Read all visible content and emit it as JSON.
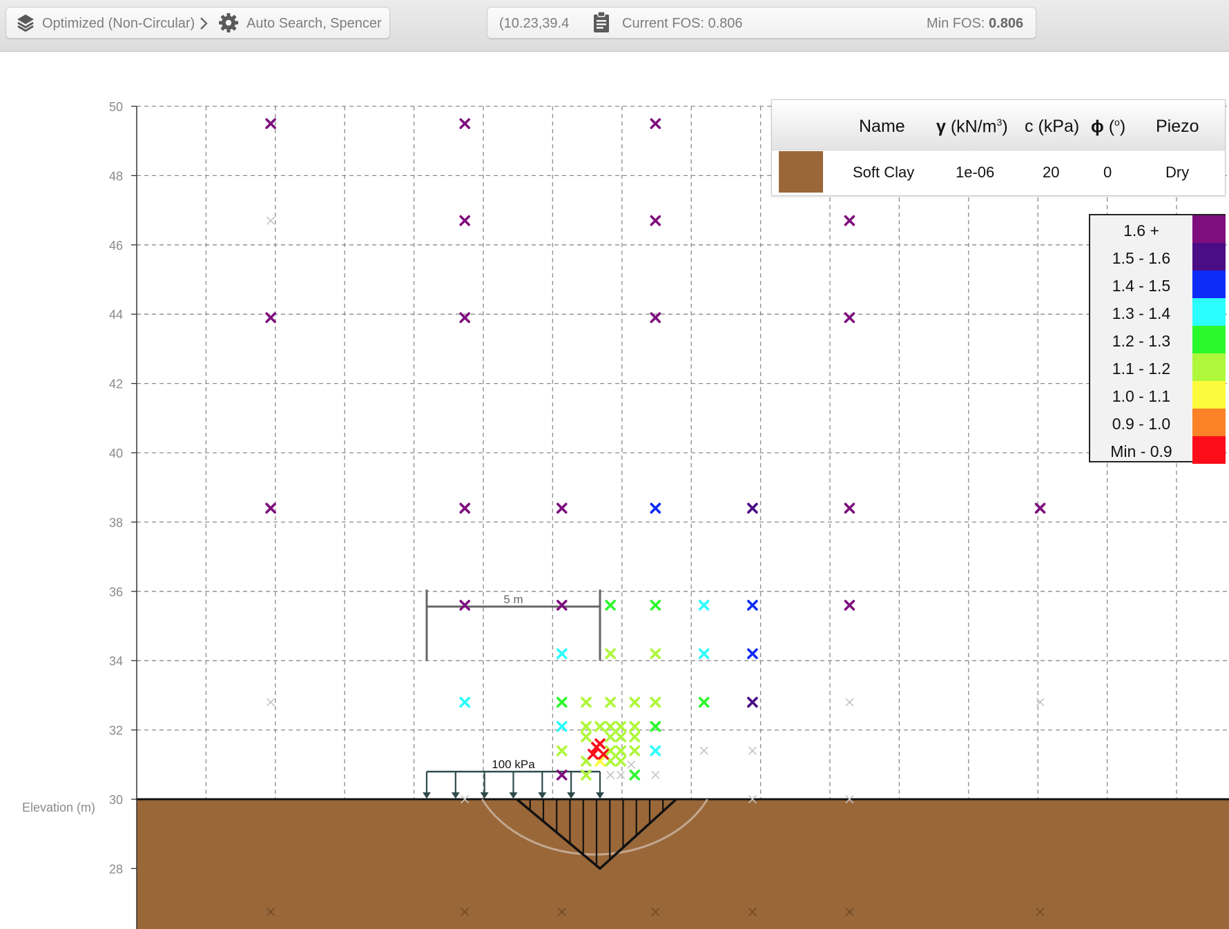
{
  "toolbar": {
    "breadcrumb_method": "Optimized (Non-Circular)",
    "breadcrumb_search": "Auto Search, Spencer",
    "coordinates": "(10.23,39.4",
    "current_fos": "Current FOS: 0.806",
    "min_fos_label": "Min FOS:",
    "min_fos_value": "0.806",
    "icons": [
      "layers-icon",
      "chevron-right-icon",
      "gear-icon",
      "clipboard-icon"
    ]
  },
  "material_table": {
    "headers": {
      "name": "Name",
      "gamma": "γ",
      "gamma_unit": "(kN/m",
      "gamma_sup": "3",
      "gamma_close": ")",
      "cohesion": "c (kPa)",
      "phi": "ϕ",
      "phi_unit": "(",
      "phi_sup": "o",
      "phi_close": ")",
      "piezo": "Piezo"
    },
    "row": {
      "name": "Soft Clay",
      "gamma": "1e-06",
      "cohesion": "20",
      "phi": "0",
      "piezo": "Dry",
      "color": "#9a6739"
    }
  },
  "legend": [
    {
      "label": "1.6 +",
      "color": "#7e0e7e"
    },
    {
      "label": "1.5 - 1.6",
      "color": "#4a0d86"
    },
    {
      "label": "1.4 - 1.5",
      "color": "#0d2cf7"
    },
    {
      "label": "1.3 - 1.4",
      "color": "#2cfdfd"
    },
    {
      "label": "1.2 - 1.3",
      "color": "#2cf92c"
    },
    {
      "label": "1.1 - 1.2",
      "color": "#aef73a"
    },
    {
      "label": "1.0 - 1.1",
      "color": "#fdf93c"
    },
    {
      "label": "0.9 - 1.0",
      "color": "#fb8227"
    },
    {
      "label": "Min - 0.9",
      "color": "#fd0d19"
    }
  ],
  "plot": {
    "y_axis_label": "Elevation (m)",
    "y_ticks": [
      28,
      30,
      32,
      34,
      36,
      38,
      40,
      42,
      44,
      46,
      48,
      50
    ],
    "load_label": "100 kPa",
    "dimension_label": "5 m",
    "ground_color": "#9a6739"
  },
  "chart_data": {
    "type": "scatter",
    "y_axis_label": "Elevation (m)",
    "y_range": [
      26.4,
      50
    ],
    "x_range": [
      -10,
      20
    ],
    "grid": true,
    "load_kpa": 100,
    "load_x_range": [
      0,
      5
    ],
    "dimension_m": 5,
    "ground_elevation": 30,
    "legend_position": "right",
    "series": [
      {
        "name": "1.6 +",
        "points": [
          [
            -4.5,
            49.5
          ],
          [
            1.1,
            49.5
          ],
          [
            6.6,
            49.5
          ],
          [
            1.1,
            46.7
          ],
          [
            6.6,
            46.7
          ],
          [
            12.2,
            46.7
          ],
          [
            -4.5,
            43.9
          ],
          [
            1.1,
            43.9
          ],
          [
            6.6,
            43.9
          ],
          [
            12.2,
            43.9
          ],
          [
            -4.5,
            38.4
          ],
          [
            1.1,
            38.4
          ],
          [
            3.9,
            38.4
          ],
          [
            12.2,
            38.4
          ],
          [
            17.7,
            38.4
          ],
          [
            1.1,
            35.6
          ],
          [
            3.9,
            35.6
          ],
          [
            12.2,
            35.6
          ],
          [
            3.9,
            30.7
          ]
        ]
      },
      {
        "name": "1.5 - 1.6",
        "points": [
          [
            9.4,
            38.4
          ],
          [
            9.4,
            32.8
          ]
        ]
      },
      {
        "name": "1.4 - 1.5",
        "points": [
          [
            6.6,
            38.4
          ],
          [
            9.4,
            35.6
          ],
          [
            9.4,
            34.2
          ]
        ]
      },
      {
        "name": "1.3 - 1.4",
        "points": [
          [
            8.0,
            35.6
          ],
          [
            3.9,
            34.2
          ],
          [
            8.0,
            34.2
          ],
          [
            1.1,
            32.8
          ],
          [
            3.9,
            32.1
          ],
          [
            6.6,
            31.4
          ]
        ]
      },
      {
        "name": "1.2 - 1.3",
        "points": [
          [
            5.3,
            35.6
          ],
          [
            6.6,
            35.6
          ],
          [
            3.9,
            32.8
          ],
          [
            8.0,
            32.8
          ],
          [
            6.6,
            32.1
          ],
          [
            6.0,
            30.7
          ]
        ]
      },
      {
        "name": "1.1 - 1.2",
        "points": [
          [
            5.3,
            34.2
          ],
          [
            6.6,
            34.2
          ],
          [
            4.6,
            32.8
          ],
          [
            5.3,
            32.8
          ],
          [
            6.0,
            32.8
          ],
          [
            6.6,
            32.8
          ],
          [
            4.6,
            32.1
          ],
          [
            5.0,
            32.1
          ],
          [
            5.3,
            32.1
          ],
          [
            5.6,
            32.1
          ],
          [
            6.0,
            32.1
          ],
          [
            4.6,
            31.8
          ],
          [
            5.3,
            31.8
          ],
          [
            5.6,
            31.8
          ],
          [
            6.0,
            31.8
          ],
          [
            3.9,
            31.4
          ],
          [
            5.3,
            31.4
          ],
          [
            5.6,
            31.4
          ],
          [
            6.0,
            31.4
          ],
          [
            4.6,
            31.1
          ],
          [
            5.3,
            31.1
          ],
          [
            5.6,
            31.1
          ],
          [
            4.6,
            30.7
          ]
        ]
      },
      {
        "name": "1.0 - 1.1",
        "points": [
          [
            5.0,
            31.1
          ]
        ]
      },
      {
        "name": "Min - 0.9",
        "points": [
          [
            4.9,
            31.5
          ],
          [
            5.1,
            31.3
          ],
          [
            4.8,
            31.3
          ],
          [
            5.0,
            31.6
          ]
        ]
      }
    ]
  }
}
